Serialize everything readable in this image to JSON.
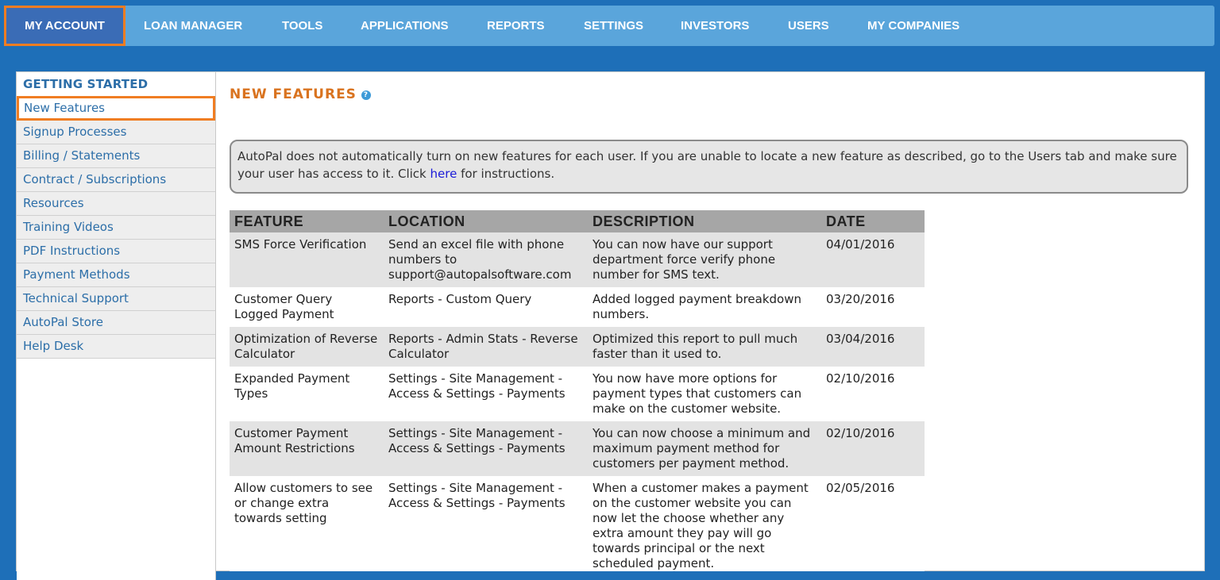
{
  "nav": {
    "items": [
      {
        "label": "MY ACCOUNT",
        "active": true
      },
      {
        "label": "LOAN MANAGER"
      },
      {
        "label": "TOOLS"
      },
      {
        "label": "APPLICATIONS"
      },
      {
        "label": "REPORTS"
      },
      {
        "label": "SETTINGS"
      },
      {
        "label": "INVESTORS"
      },
      {
        "label": "USERS"
      },
      {
        "label": "MY COMPANIES"
      }
    ]
  },
  "sidebar": {
    "heading": "GETTING STARTED",
    "items": [
      {
        "label": "New Features",
        "active": true
      },
      {
        "label": "Signup Processes"
      },
      {
        "label": "Billing / Statements"
      },
      {
        "label": "Contract / Subscriptions"
      },
      {
        "label": "Resources"
      },
      {
        "label": "Training Videos"
      },
      {
        "label": "PDF Instructions"
      },
      {
        "label": "Payment Methods"
      },
      {
        "label": "Technical Support"
      },
      {
        "label": "AutoPal Store"
      },
      {
        "label": "Help Desk"
      }
    ]
  },
  "main": {
    "title": "NEW FEATURES",
    "help_icon": "question-icon",
    "notice": {
      "text_before": "AutoPal does not automatically turn on new features for each user. If you are unable to locate a new feature as described, go to the Users tab and make sure your user has access to it. Click ",
      "link": "here",
      "text_after": " for instructions."
    },
    "table": {
      "headers": [
        "FEATURE",
        "LOCATION",
        "DESCRIPTION",
        "DATE"
      ],
      "rows": [
        [
          "SMS Force Verification",
          "Send an excel file with phone numbers to support@autopalsoftware.com",
          "You can now have our support department force verify phone number for SMS text.",
          "04/01/2016"
        ],
        [
          "Customer Query Logged Payment",
          "Reports - Custom Query",
          "Added logged payment breakdown numbers.",
          "03/20/2016"
        ],
        [
          "Optimization of Reverse Calculator",
          "Reports - Admin Stats - Reverse Calculator",
          "Optimized this report to pull much faster than it used to.",
          "03/04/2016"
        ],
        [
          "Expanded Payment Types",
          "Settings - Site Management - Access & Settings - Payments",
          "You now have more options for payment types that customers can make on the customer website.",
          "02/10/2016"
        ],
        [
          "Customer Payment Amount Restrictions",
          "Settings - Site Management - Access & Settings - Payments",
          "You can now choose a minimum and maximum payment method for customers per payment method.",
          "02/10/2016"
        ],
        [
          "Allow customers to see or change extra towards setting",
          "Settings - Site Management - Access & Settings - Payments",
          "When a customer makes a payment on the customer website you can now let the choose whether any extra amount they pay will go towards principal or the next scheduled payment.",
          "02/05/2016"
        ]
      ]
    }
  },
  "colors": {
    "nav_bg": "#5aa5db",
    "nav_active": "#3a6cb6",
    "highlight": "#f07d22",
    "page_bg": "#1e6fb8",
    "title": "#d9731f",
    "link": "#2c6ea8"
  }
}
